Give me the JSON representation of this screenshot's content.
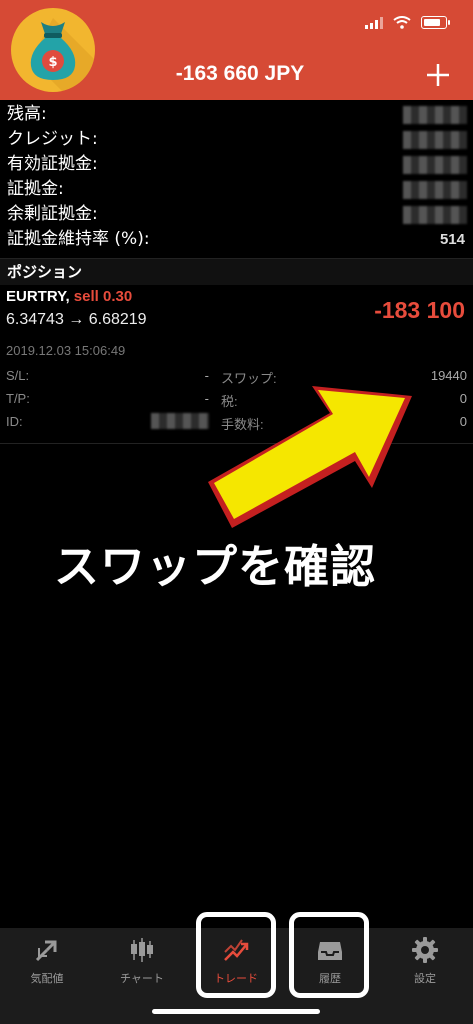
{
  "header": {
    "title": "-163 660 JPY",
    "add_icon": "plus-icon",
    "logo_icon": "money-bag-icon"
  },
  "account": {
    "balance_label": "残高:",
    "credit_label": "クレジット:",
    "equity_label": "有効証拠金:",
    "margin_label": "証拠金:",
    "free_margin_label": "余剰証拠金:",
    "margin_level_label": "証拠金維持率 (%):",
    "margin_level_value": "514"
  },
  "positions": {
    "section_title": "ポジション",
    "item": {
      "symbol": "EURTRY,",
      "type": "sell 0.30",
      "prices": "6.34743 → 6.68219",
      "profit": "-183 100",
      "time": "2019.12.03 15:06:49",
      "sl_label": "S/L:",
      "sl_value": "-",
      "tp_label": "T/P:",
      "tp_value": "-",
      "id_label": "ID:",
      "swap_label": "スワップ:",
      "swap_value": "19440",
      "tax_label": "税:",
      "tax_value": "0",
      "commission_label": "手数料:",
      "commission_value": "0"
    }
  },
  "annotation": {
    "text": "スワップを確認"
  },
  "tabbar": {
    "tabs": [
      {
        "label": "気配値",
        "icon": "quotes-icon"
      },
      {
        "label": "チャート",
        "icon": "candlestick-icon"
      },
      {
        "label": "トレード",
        "icon": "trade-icon"
      },
      {
        "label": "履歴",
        "icon": "inbox-icon"
      },
      {
        "label": "設定",
        "icon": "gear-icon"
      }
    ]
  },
  "colors": {
    "header_bg": "#d64a35",
    "loss_red": "#e74c3c",
    "arrow_yellow": "#f5e700"
  }
}
